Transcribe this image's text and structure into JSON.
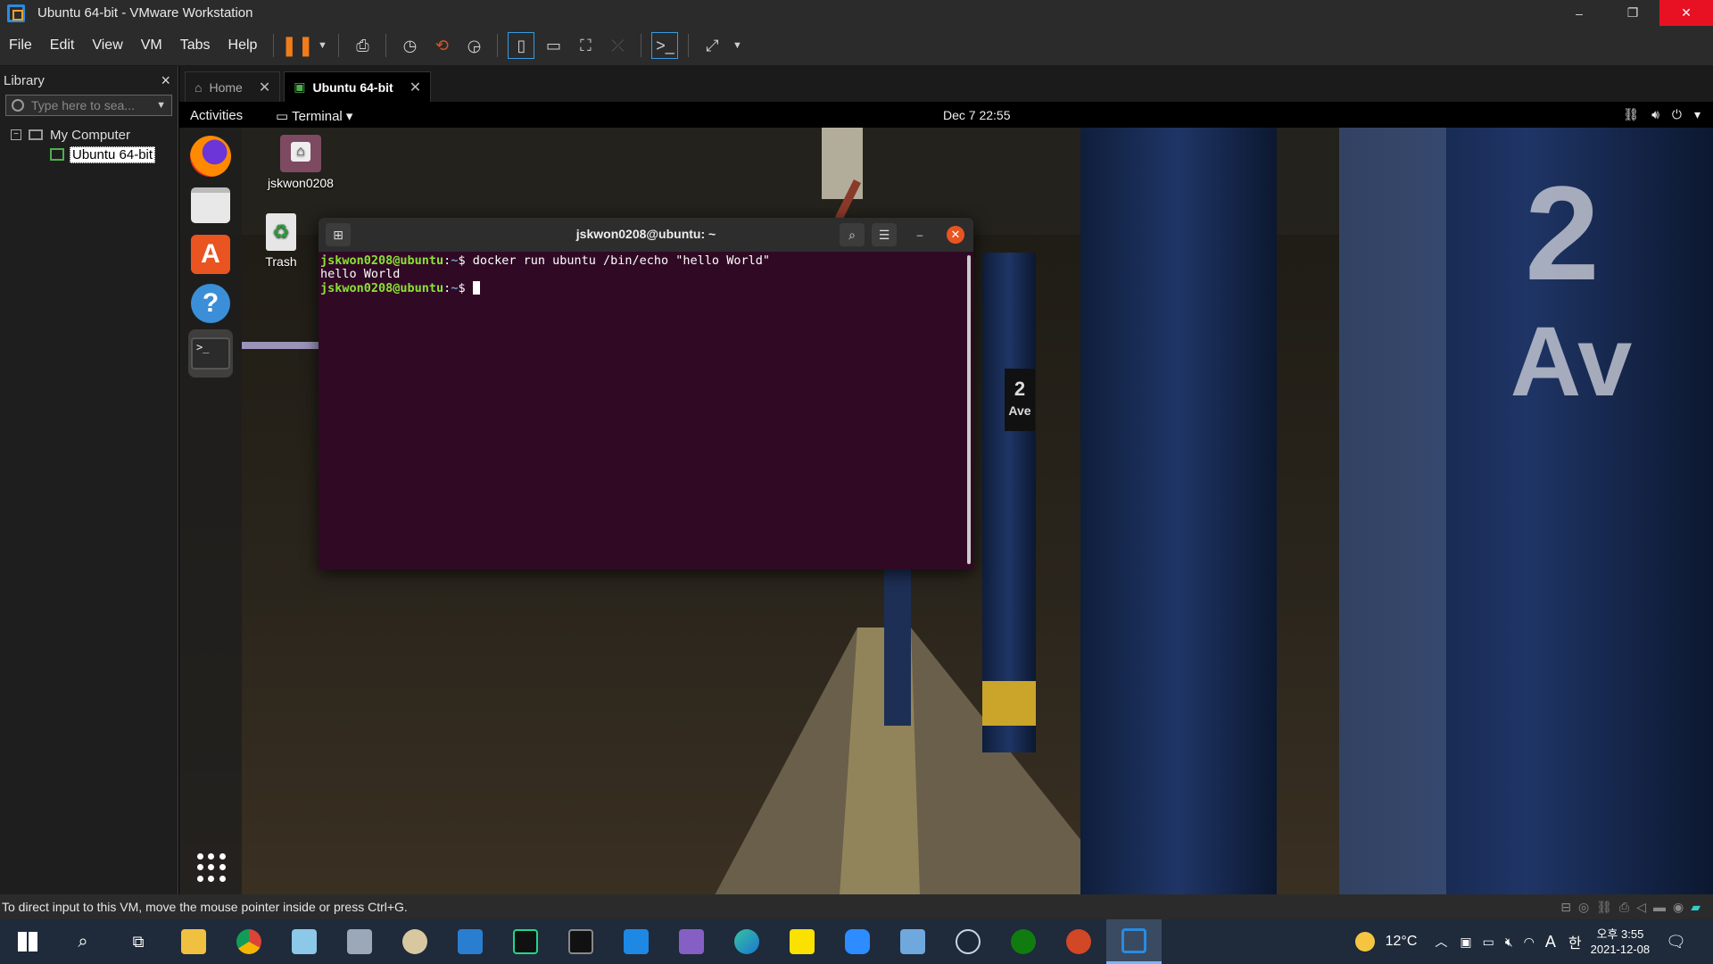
{
  "window": {
    "title": "Ubuntu 64-bit - VMware Workstation",
    "controls": [
      "–",
      "❐",
      "✕"
    ]
  },
  "menus": [
    "File",
    "Edit",
    "View",
    "VM",
    "Tabs",
    "Help"
  ],
  "library": {
    "title": "Library",
    "close_label": "×",
    "search_placeholder": "Type here to sea...",
    "tree": {
      "root": "My Computer",
      "child": "Ubuntu 64-bit"
    }
  },
  "tabs": [
    {
      "label": "Home"
    },
    {
      "label": "Ubuntu 64-bit"
    }
  ],
  "gnome": {
    "activities": "Activities",
    "app_menu": "Terminal ▾",
    "clock": "Dec 7  22:55",
    "status_icons": [
      "network-icon",
      "volume-icon",
      "power-icon"
    ]
  },
  "desktop_icons": {
    "home": "jskwon0208",
    "trash": "Trash"
  },
  "terminal": {
    "title": "jskwon0208@ubuntu: ~",
    "lines": [
      {
        "user": "jskwon0208@ubuntu",
        "path": "~",
        "cmd": "docker run ubuntu /bin/echo \"hello World\""
      },
      {
        "output": "hello World"
      },
      {
        "user": "jskwon0208@ubuntu",
        "path": "~",
        "cmd": ""
      }
    ]
  },
  "statusbar": {
    "message": "To direct input to this VM, move the mouse pointer inside or press Ctrl+G."
  },
  "taskbar": {
    "apps": [
      "start-icon",
      "search-icon",
      "task-view-icon",
      "file-explorer-icon",
      "chrome-icon",
      "notepad-icon",
      "calculator-icon",
      "paint-icon",
      "app-icon",
      "pycharm-icon",
      "cmd-icon",
      "vscode-icon",
      "visual-studio-icon",
      "edge-icon",
      "kakaotalk-icon",
      "zoom-icon",
      "app2-icon",
      "steam-icon",
      "xbox-icon",
      "powerpoint-icon",
      "vmware-icon"
    ],
    "temperature": "12°C",
    "ime": "A",
    "ime2": "한",
    "time": "오후 3:55",
    "date": "2021-12-08"
  },
  "colors": {
    "accent": "#e95420",
    "terminal_bg": "#300a24",
    "prompt_green": "#8ae234",
    "prompt_blue": "#729fcf"
  }
}
